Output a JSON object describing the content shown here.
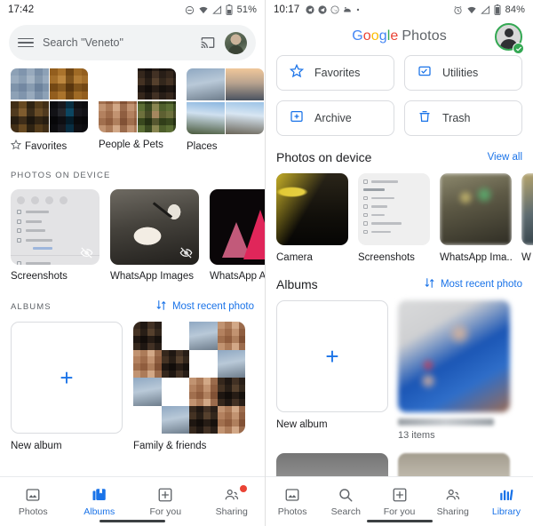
{
  "left": {
    "status": {
      "time": "17:42",
      "battery": "51%",
      "icons": [
        "dnd-icon",
        "wifi-icon",
        "signal-icon",
        "battery-icon"
      ]
    },
    "search": {
      "placeholder": "Search \"Veneto\"",
      "menu_icon": "hamburger-menu-icon",
      "cast_icon": "cast-icon",
      "avatar_icon": "account-avatar"
    },
    "categories": [
      {
        "label": "Favorites",
        "icon": "star-icon"
      },
      {
        "label": "People & Pets",
        "icon": ""
      },
      {
        "label": "Places",
        "icon": ""
      }
    ],
    "device_section": {
      "title": "PHOTOS ON DEVICE"
    },
    "device_folders": [
      {
        "label": "Screenshots",
        "badge_icon": "no-backup-icon"
      },
      {
        "label": "WhatsApp Images",
        "badge_icon": "no-backup-icon"
      },
      {
        "label": "WhatsApp A",
        "badge_icon": ""
      }
    ],
    "albums_section": {
      "title": "ALBUMS",
      "sort_label": "Most recent photo",
      "sort_icon": "sort-icon"
    },
    "albums": [
      {
        "label": "New album",
        "icon": "plus-icon"
      },
      {
        "label": "Family & friends",
        "icon": ""
      }
    ],
    "bottom_nav": [
      {
        "label": "Photos",
        "icon": "photos-icon",
        "active": false,
        "badge": false
      },
      {
        "label": "Albums",
        "icon": "albums-icon",
        "active": true,
        "badge": false
      },
      {
        "label": "For you",
        "icon": "for-you-icon",
        "active": false,
        "badge": false
      },
      {
        "label": "Sharing",
        "icon": "sharing-icon",
        "active": false,
        "badge": true
      }
    ]
  },
  "right": {
    "status": {
      "time": "10:17",
      "battery": "84%",
      "icons": [
        "telegram-icon",
        "telegram-icon",
        "whatsapp-icon",
        "app-icon",
        "dot-icon",
        "alarm-icon",
        "wifi-icon",
        "signal-icon",
        "battery-icon"
      ]
    },
    "header": {
      "brand_g": "G",
      "brand_o1": "o",
      "brand_o2": "o",
      "brand_g2": "g",
      "brand_l": "l",
      "brand_e": "e",
      "product": "Photos",
      "avatar_icon": "account-avatar",
      "verified_icon": "verified-check-icon"
    },
    "quick_cards": [
      {
        "label": "Favorites",
        "icon": "star-icon"
      },
      {
        "label": "Utilities",
        "icon": "utilities-icon"
      },
      {
        "label": "Archive",
        "icon": "archive-icon"
      },
      {
        "label": "Trash",
        "icon": "trash-icon"
      }
    ],
    "device_section": {
      "title": "Photos on device",
      "link_label": "View all"
    },
    "device_folders": [
      {
        "label": "Camera"
      },
      {
        "label": "Screenshots"
      },
      {
        "label": "WhatsApp Ima..."
      },
      {
        "label": "W"
      }
    ],
    "albums_section": {
      "title": "Albums",
      "sort_label": "Most recent photo",
      "sort_icon": "sort-icon"
    },
    "albums": [
      {
        "label": "New album",
        "count": "",
        "icon": "plus-icon"
      },
      {
        "label": "",
        "count": "13 items",
        "icon": ""
      }
    ],
    "bottom_nav": [
      {
        "label": "Photos",
        "icon": "photos-icon",
        "active": false
      },
      {
        "label": "Search",
        "icon": "search-icon",
        "active": false
      },
      {
        "label": "For you",
        "icon": "for-you-icon",
        "active": false
      },
      {
        "label": "Sharing",
        "icon": "sharing-icon",
        "active": false
      },
      {
        "label": "Library",
        "icon": "library-icon",
        "active": true
      }
    ]
  },
  "colors": {
    "accent": "#1a73e8",
    "text": "#202124",
    "muted": "#5f6368",
    "badge": "#ea4335",
    "verified": "#34a853"
  }
}
